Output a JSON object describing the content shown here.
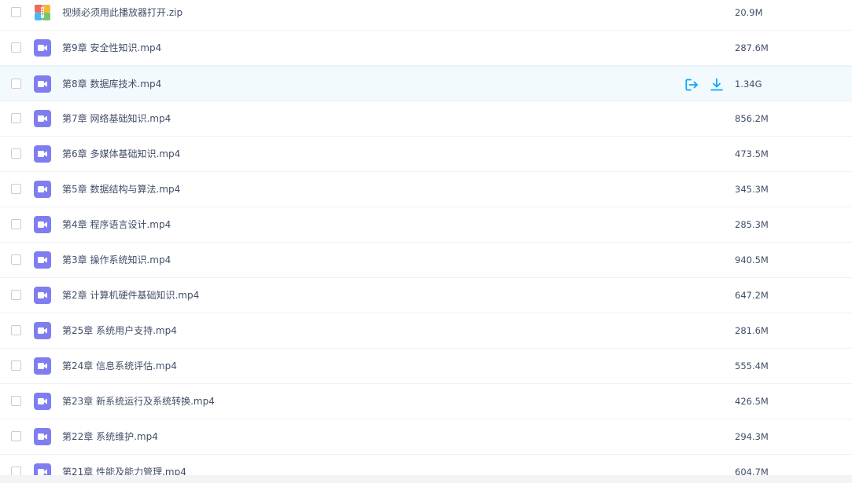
{
  "files": [
    {
      "name": "视频必须用此播放器打开.zip",
      "size": "20.9M",
      "icon": "zip-archive-icon"
    },
    {
      "name": "第9章 安全性知识.mp4",
      "size": "287.6M",
      "icon": "video-file-icon"
    },
    {
      "name": "第8章 数据库技术.mp4",
      "size": "1.34G",
      "icon": "video-file-icon",
      "hovered": true
    },
    {
      "name": "第7章 网络基础知识.mp4",
      "size": "856.2M",
      "icon": "video-file-icon"
    },
    {
      "name": "第6章 多媒体基础知识.mp4",
      "size": "473.5M",
      "icon": "video-file-icon"
    },
    {
      "name": "第5章 数据结构与算法.mp4",
      "size": "345.3M",
      "icon": "video-file-icon"
    },
    {
      "name": "第4章 程序语言设计.mp4",
      "size": "285.3M",
      "icon": "video-file-icon"
    },
    {
      "name": "第3章 操作系统知识.mp4",
      "size": "940.5M",
      "icon": "video-file-icon"
    },
    {
      "name": "第2章 计算机硬件基础知识.mp4",
      "size": "647.2M",
      "icon": "video-file-icon"
    },
    {
      "name": "第25章 系统用户支持.mp4",
      "size": "281.6M",
      "icon": "video-file-icon"
    },
    {
      "name": "第24章 信息系统评估.mp4",
      "size": "555.4M",
      "icon": "video-file-icon"
    },
    {
      "name": "第23章 新系统运行及系统转换.mp4",
      "size": "426.5M",
      "icon": "video-file-icon"
    },
    {
      "name": "第22章 系统维护.mp4",
      "size": "294.3M",
      "icon": "video-file-icon"
    },
    {
      "name": "第21章 性能及能力管理.mp4",
      "size": "604.7M",
      "icon": "video-file-icon"
    }
  ],
  "hover_actions": {
    "share_icon": "share-export-icon",
    "download_icon": "download-icon"
  },
  "colors": {
    "text": "#424e67",
    "accent": "#06a7ff",
    "video_icon": "#7f7ef0",
    "hover_row": "#f3fafe"
  }
}
